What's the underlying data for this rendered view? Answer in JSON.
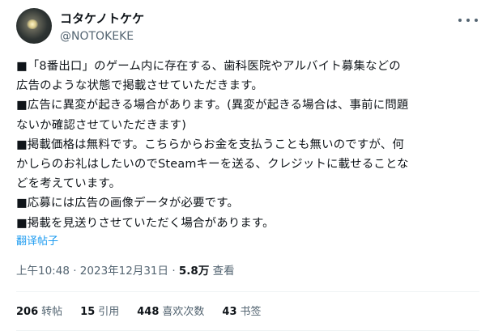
{
  "author": {
    "display_name": "コタケノトケケ",
    "handle": "@NOTOKEKE"
  },
  "tweet": {
    "lines": [
      "■「8番出口」のゲーム内に存在する、歯科医院やアルバイト募集などの",
      "広告のような状態で掲載させていただきます。",
      "■広告に異変が起きる場合があります。(異変が起きる場合は、事前に問題",
      "ないか確認させていただきます)",
      "■掲載価格は無料です。こちらからお金を支払うことも無いのですが、何",
      "かしらのお礼はしたいのでSteamキーを送る、クレジットに載せることな",
      "どを考えています。",
      "■応募には広告の画像データが必要です。",
      "■掲載を見送りさせていただく場合があります。"
    ],
    "translate_label": "翻译帖子"
  },
  "meta": {
    "time": "上午10:48",
    "date": "2023年12月31日",
    "separator": "·",
    "views_count": "5.8万",
    "views_label": "查看"
  },
  "stats": [
    {
      "count": "206",
      "label": "转帖"
    },
    {
      "count": "15",
      "label": "引用"
    },
    {
      "count": "448",
      "label": "喜欢次数"
    },
    {
      "count": "43",
      "label": "书签"
    }
  ],
  "icons": {
    "more": "more-horizontal-icon"
  }
}
